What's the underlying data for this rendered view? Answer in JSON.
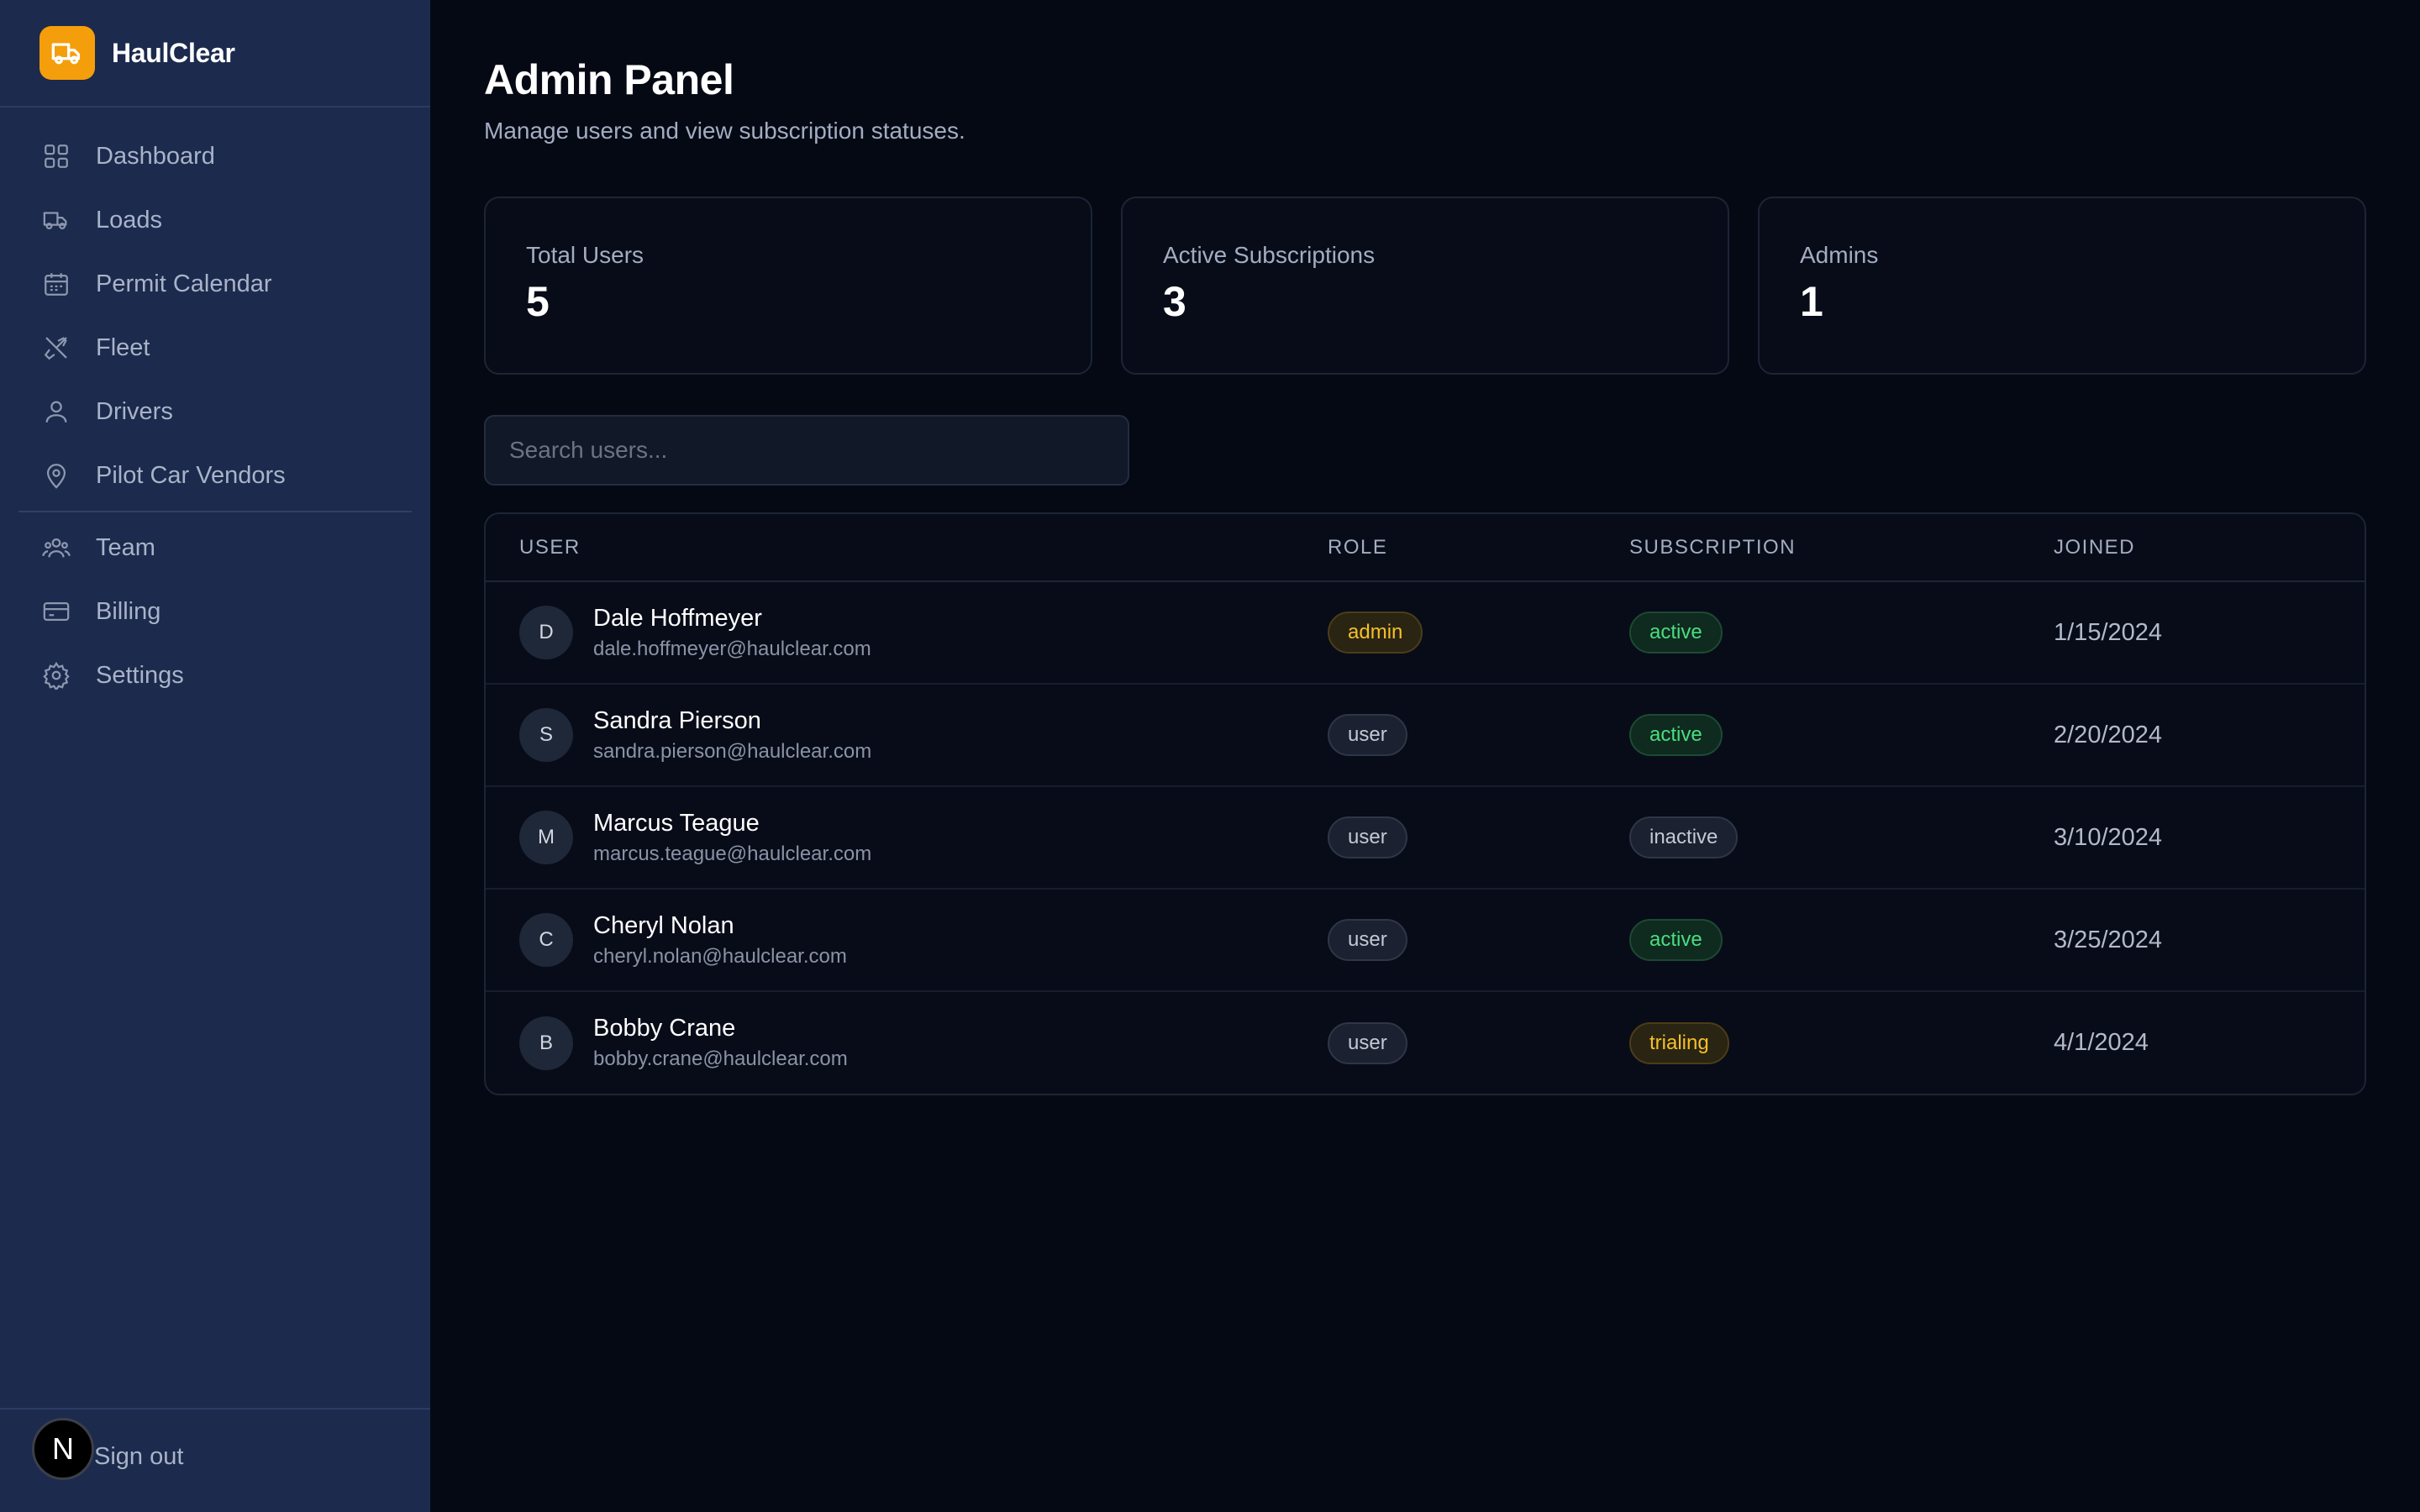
{
  "brand": {
    "name": "HaulClear",
    "logo_icon": "truck-icon",
    "accent": "#f59e0b"
  },
  "sidebar": {
    "items": [
      {
        "label": "Dashboard",
        "icon": "grid-icon"
      },
      {
        "label": "Loads",
        "icon": "truck-icon"
      },
      {
        "label": "Permit Calendar",
        "icon": "calendar-icon"
      },
      {
        "label": "Fleet",
        "icon": "tools-icon"
      },
      {
        "label": "Drivers",
        "icon": "user-icon"
      },
      {
        "label": "Pilot Car Vendors",
        "icon": "map-pin-icon"
      }
    ],
    "secondary_items": [
      {
        "label": "Team",
        "icon": "users-icon"
      },
      {
        "label": "Billing",
        "icon": "credit-card-icon"
      },
      {
        "label": "Settings",
        "icon": "gear-icon"
      }
    ],
    "footer": {
      "sign_out": "Sign out",
      "badge_letter": "N"
    }
  },
  "header": {
    "title": "Admin Panel",
    "subtitle": "Manage users and view subscription statuses."
  },
  "stats": [
    {
      "label": "Total Users",
      "value": "5"
    },
    {
      "label": "Active Subscriptions",
      "value": "3"
    },
    {
      "label": "Admins",
      "value": "1"
    }
  ],
  "search": {
    "placeholder": "Search users...",
    "value": ""
  },
  "table": {
    "headers": {
      "user": "USER",
      "role": "ROLE",
      "subscription": "SUBSCRIPTION",
      "joined": "JOINED"
    },
    "rows": [
      {
        "initial": "D",
        "name": "Dale Hoffmeyer",
        "email": "dale.hoffmeyer@haulclear.com",
        "role": "admin",
        "subscription": "active",
        "joined": "1/15/2024"
      },
      {
        "initial": "S",
        "name": "Sandra Pierson",
        "email": "sandra.pierson@haulclear.com",
        "role": "user",
        "subscription": "active",
        "joined": "2/20/2024"
      },
      {
        "initial": "M",
        "name": "Marcus Teague",
        "email": "marcus.teague@haulclear.com",
        "role": "user",
        "subscription": "inactive",
        "joined": "3/10/2024"
      },
      {
        "initial": "C",
        "name": "Cheryl Nolan",
        "email": "cheryl.nolan@haulclear.com",
        "role": "user",
        "subscription": "active",
        "joined": "3/25/2024"
      },
      {
        "initial": "B",
        "name": "Bobby Crane",
        "email": "bobby.crane@haulclear.com",
        "role": "user",
        "subscription": "trialing",
        "joined": "4/1/2024"
      }
    ]
  },
  "colors": {
    "sidebar_bg": "#1b2a4d",
    "main_bg": "#050914",
    "active_green": "#4ade80",
    "warn_yellow": "#f5c02a"
  }
}
